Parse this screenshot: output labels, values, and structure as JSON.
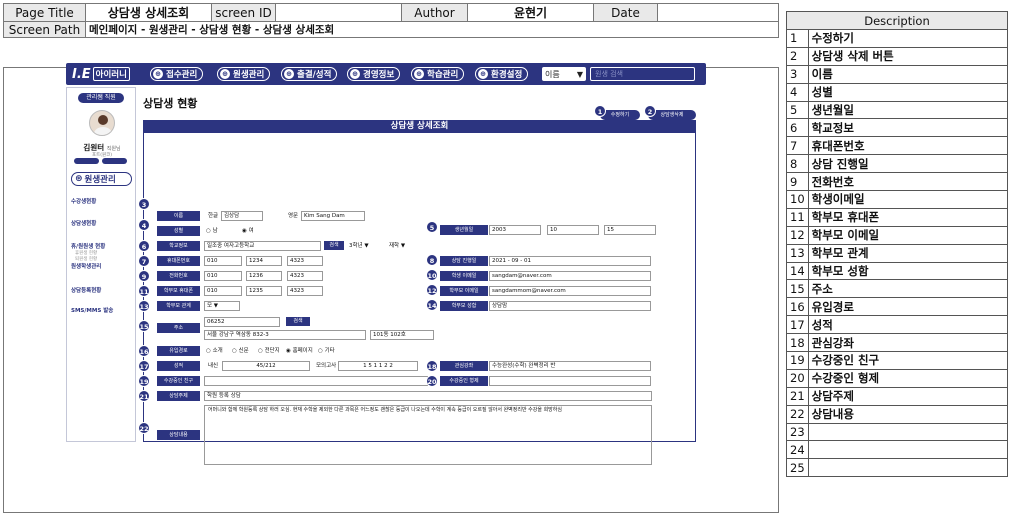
{
  "header": {
    "page_title_label": "Page Title",
    "page_title": "상담생 상세조회",
    "screen_id_label": "screen ID",
    "screen_id": "",
    "author_label": "Author",
    "author": "윤현기",
    "date_label": "Date",
    "date": "",
    "screen_path_label": "Screen Path",
    "screen_path": "메인페이지 - 원생관리 - 상담생 현황 - 상담생 상세조회"
  },
  "app": {
    "logo_mark": "I.E",
    "logo_text": "아이러니",
    "nav": [
      {
        "icon": "⊕",
        "label": "접수관리"
      },
      {
        "icon": "⊕",
        "label": "원생관리"
      },
      {
        "icon": "⊕",
        "label": "출결/성적"
      },
      {
        "icon": "⊕",
        "label": "경영정보"
      },
      {
        "icon": "⊕",
        "label": "학습관리"
      },
      {
        "icon": "⊕",
        "label": "환경설정"
      }
    ],
    "search_select": "이름",
    "search_placeholder": "원생 검색",
    "sidebar": {
      "role": "관리쌤 직원",
      "user_name": "김원터",
      "user_suffix": "직원님",
      "user_sub": "포트(원코)",
      "manager_title": "원생관리",
      "menu": [
        "수강생현황",
        "상담생현황",
        "휴/원원생 현황",
        "원생학생관리",
        "상담등록현황",
        "SMS/MMS 발송"
      ],
      "sub_menu": [
        "휴원생 현황",
        "퇴원생 현황"
      ]
    },
    "page_heading": "상담생 현황",
    "edit_button": "수정하기",
    "delete_button": "상담생삭제",
    "form_title": "상담생 상세조회",
    "form": {
      "name_label": "이름",
      "name_kor_prefix": "한글",
      "name_kor": "김상담",
      "name_eng_prefix": "영문",
      "name_eng": "Kim Sang Dam",
      "gender_label": "성별",
      "gender_options": [
        "남",
        "여"
      ],
      "birth_label": "생년월일",
      "birth_year": "2003",
      "birth_month": "10",
      "birth_day": "15",
      "school_label": "학교정보",
      "school": "일조중 여자고등학교",
      "search_btn": "검색",
      "grade": "3학년",
      "status": "재학",
      "phone_label": "휴대폰번호",
      "phone": [
        "010",
        "1234",
        "4323"
      ],
      "consult_date_label": "상담 진행일",
      "consult_date": "2021 - 09 - 01",
      "tel_label": "전화번호",
      "tel": [
        "010",
        "1236",
        "4323"
      ],
      "email_label": "학생 이메일",
      "email": "sangdam@naver.com",
      "parent_phone_label": "학부모 휴대폰",
      "parent_phone": [
        "010",
        "1235",
        "4323"
      ],
      "parent_email_label": "학부모 이메일",
      "parent_email": "sangdammom@naver.com",
      "relation_label": "학부모 관계",
      "relation": "모",
      "parent_name_label": "학부모 성함",
      "parent_name": "상담맘",
      "zip": "06252",
      "address_label": "주소",
      "address": "서울 강남구 역삼동 832-3",
      "address_detail": "101동 102호",
      "route_label": "유입경로",
      "route_options": [
        "소개",
        "신문",
        "전단지",
        "홈페이지",
        "기타"
      ],
      "grade_score_label": "성적",
      "score_prefix": "내신",
      "score": "45/212",
      "mock_prefix": "모의고사",
      "mock": "1 5 1 1 2 2",
      "interest_label": "관심강좌",
      "interest": "수능완성(수학) 완벽정리 반",
      "friend_label": "수강중인 친구",
      "sibling_label": "수강중인 형제",
      "subject_label": "상담주제",
      "subject": "학원 등록 상담",
      "content_label": "상담내용",
      "content": "어머니와 함께 학원등록 상담 하러 오심. 현재 수학을 제외한 다른 과목은 어느정도 괜찮은 등급이 나오는데 수학이 계속 등급이 오르질 않아서 완벽정리반 수강을 희망하심"
    }
  },
  "description": {
    "title": "Description",
    "items": [
      {
        "no": "1",
        "label": "수정하기"
      },
      {
        "no": "2",
        "label": "상담생 삭제 버튼"
      },
      {
        "no": "3",
        "label": "이름"
      },
      {
        "no": "4",
        "label": "성별"
      },
      {
        "no": "5",
        "label": "생년월일"
      },
      {
        "no": "6",
        "label": "학교정보"
      },
      {
        "no": "7",
        "label": "휴대폰번호"
      },
      {
        "no": "8",
        "label": "상담 진행일"
      },
      {
        "no": "9",
        "label": "전화번호"
      },
      {
        "no": "10",
        "label": "학생이메일"
      },
      {
        "no": "11",
        "label": "학부모 휴대폰"
      },
      {
        "no": "12",
        "label": "학부모 이메일"
      },
      {
        "no": "13",
        "label": "학부모 관계"
      },
      {
        "no": "14",
        "label": "학부모 성함"
      },
      {
        "no": "15",
        "label": "주소"
      },
      {
        "no": "16",
        "label": "유입경로"
      },
      {
        "no": "17",
        "label": "성적"
      },
      {
        "no": "18",
        "label": "관심강좌"
      },
      {
        "no": "19",
        "label": "수강중인 친구"
      },
      {
        "no": "20",
        "label": "수강중인 형제"
      },
      {
        "no": "21",
        "label": "상담주제"
      },
      {
        "no": "22",
        "label": "상담내용"
      },
      {
        "no": "23",
        "label": ""
      },
      {
        "no": "24",
        "label": ""
      },
      {
        "no": "25",
        "label": ""
      }
    ]
  },
  "colors": {
    "brand": "#2c3480",
    "header_bg": "#e9e9e9"
  }
}
